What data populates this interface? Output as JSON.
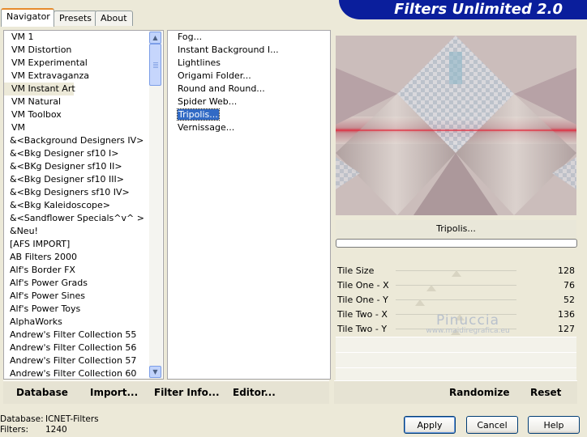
{
  "tabs": [
    "Navigator",
    "Presets",
    "About"
  ],
  "app_title": "Filters Unlimited 2.0",
  "categories": [
    "VM 1",
    "VM Distortion",
    "VM Experimental",
    "VM Extravaganza",
    "VM Instant Art",
    "VM Natural",
    "VM Toolbox",
    "VM",
    "&<Background Designers IV>",
    "&<Bkg Designer sf10 I>",
    "&<BKg Designer sf10 II>",
    "&<Bkg Designer sf10 III>",
    "&<Bkg Designers sf10 IV>",
    "&<Bkg Kaleidoscope>",
    "&<Sandflower Specials^v^ >",
    "&Neu!",
    "[AFS IMPORT]",
    "AB Filters 2000",
    "Alf's Border FX",
    "Alf's Power Grads",
    "Alf's Power Sines",
    "Alf's Power Toys",
    "AlphaWorks",
    "Andrew's Filter Collection 55",
    "Andrew's Filter Collection 56",
    "Andrew's Filter Collection 57",
    "Andrew's Filter Collection 60"
  ],
  "selected_category": "VM Instant Art",
  "filters": [
    "Fog...",
    "Instant Background I...",
    "Lightlines",
    "Origami Folder...",
    "Round and Round...",
    "Spider Web...",
    "Tripolis...",
    "Vernissage..."
  ],
  "selected_filter": "Tripolis...",
  "filter_name": "Tripolis...",
  "progress": 0,
  "params": [
    {
      "label": "Tile Size",
      "value": 128
    },
    {
      "label": "Tile One - X",
      "value": 76
    },
    {
      "label": "Tile One - Y",
      "value": 52
    },
    {
      "label": "Tile Two - X",
      "value": 136
    },
    {
      "label": "Tile Two - Y",
      "value": 127
    }
  ],
  "param_max": 255,
  "watermark": {
    "line1": "Pinuccia",
    "line2": "www.maidiregrafica.eu"
  },
  "left_bar": {
    "database": "Database",
    "import": "Import...",
    "filter_info": "Filter Info...",
    "editor": "Editor..."
  },
  "right_bar": {
    "randomize": "Randomize",
    "reset": "Reset"
  },
  "status": {
    "database_label": "Database:",
    "database_value": "ICNET-Filters",
    "filters_label": "Filters:",
    "filters_value": "1240"
  },
  "buttons": {
    "apply": "Apply",
    "cancel": "Cancel",
    "help": "Help"
  },
  "colors": {
    "banner": "#0a1e9c",
    "selection": "#316ac5",
    "background": "#ece9d8"
  },
  "icons": {
    "scroll_up": "chevron-up-icon",
    "scroll_down": "chevron-down-icon"
  }
}
